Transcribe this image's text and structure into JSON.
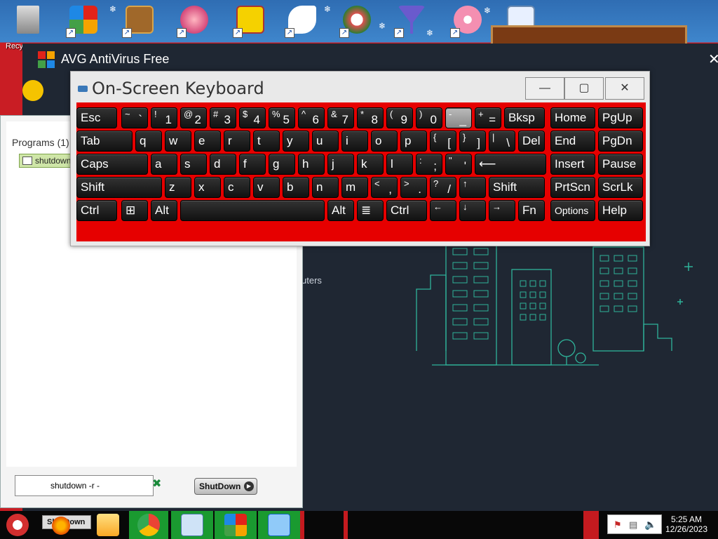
{
  "desktop": {
    "recycle_label": "Recy",
    "colors": {
      "accent": "#c91d24",
      "sky": "#3f86cc"
    }
  },
  "avg": {
    "title": "AVG AntiVirus Free",
    "close_glyph": "✕",
    "side_text": "uters"
  },
  "programs": {
    "label": "Programs (1)",
    "item": "shutdown",
    "command_value": "shutdown -r -",
    "clear_glyph": "✖",
    "shutdown_button": "ShutDown"
  },
  "osk": {
    "title": "On-Screen Keyboard",
    "minimize": "—",
    "maximize": "▢",
    "close": "✕",
    "rows": [
      [
        {
          "main": "Esc"
        },
        {
          "top": "~",
          "bot": "`"
        },
        {
          "top": "!",
          "bot": "1"
        },
        {
          "top": "@",
          "bot": "2"
        },
        {
          "top": "#",
          "bot": "3"
        },
        {
          "top": "$",
          "bot": "4"
        },
        {
          "top": "%",
          "bot": "5"
        },
        {
          "top": "^",
          "bot": "6"
        },
        {
          "top": "&",
          "bot": "7"
        },
        {
          "top": "*",
          "bot": "8"
        },
        {
          "top": "(",
          "bot": "9"
        },
        {
          "top": ")",
          "bot": "0"
        },
        {
          "top": "-",
          "bot": "_",
          "pressed": true
        },
        {
          "top": "+",
          "bot": "="
        },
        {
          "main": "Bksp"
        },
        {
          "main": "Home"
        },
        {
          "main": "PgUp"
        }
      ],
      [
        {
          "main": "Tab"
        },
        {
          "main": "q"
        },
        {
          "main": "w"
        },
        {
          "main": "e"
        },
        {
          "main": "r"
        },
        {
          "main": "t"
        },
        {
          "main": "y"
        },
        {
          "main": "u"
        },
        {
          "main": "i"
        },
        {
          "main": "o"
        },
        {
          "main": "p"
        },
        {
          "top": "{",
          "bot": "["
        },
        {
          "top": "}",
          "bot": "]"
        },
        {
          "top": "|",
          "bot": "\\"
        },
        {
          "main": "Del"
        },
        {
          "main": "End"
        },
        {
          "main": "PgDn"
        }
      ],
      [
        {
          "main": "Caps"
        },
        {
          "main": "a"
        },
        {
          "main": "s"
        },
        {
          "main": "d"
        },
        {
          "main": "f"
        },
        {
          "main": "g"
        },
        {
          "main": "h"
        },
        {
          "main": "j"
        },
        {
          "main": "k"
        },
        {
          "main": "l"
        },
        {
          "top": ":",
          "bot": ";"
        },
        {
          "top": "\"",
          "bot": "'"
        },
        {
          "main": "⟵"
        },
        {
          "main": "Insert"
        },
        {
          "main": "Pause"
        }
      ],
      [
        {
          "main": "Shift"
        },
        {
          "main": "z"
        },
        {
          "main": "x"
        },
        {
          "main": "c"
        },
        {
          "main": "v"
        },
        {
          "main": "b"
        },
        {
          "main": "n"
        },
        {
          "main": "m"
        },
        {
          "top": "<",
          "bot": ","
        },
        {
          "top": ">",
          "bot": "."
        },
        {
          "top": "?",
          "bot": "/"
        },
        {
          "top": "↑"
        },
        {
          "main": "Shift"
        },
        {
          "main": "PrtScn"
        },
        {
          "main": "ScrLk"
        }
      ],
      [
        {
          "main": "Ctrl"
        },
        {
          "main": "⊞"
        },
        {
          "main": "Alt"
        },
        {
          "main": ""
        },
        {
          "main": "Alt"
        },
        {
          "main": "≣"
        },
        {
          "main": "Ctrl"
        },
        {
          "top": "←"
        },
        {
          "top": "↓"
        },
        {
          "top": "→"
        },
        {
          "main": "Fn"
        },
        {
          "main": "Options"
        },
        {
          "main": "Help"
        }
      ]
    ]
  },
  "taskbar": {
    "clock_time": "5:25 AM",
    "clock_date": "12/26/2023",
    "shutdown_label": "ShutDown"
  }
}
